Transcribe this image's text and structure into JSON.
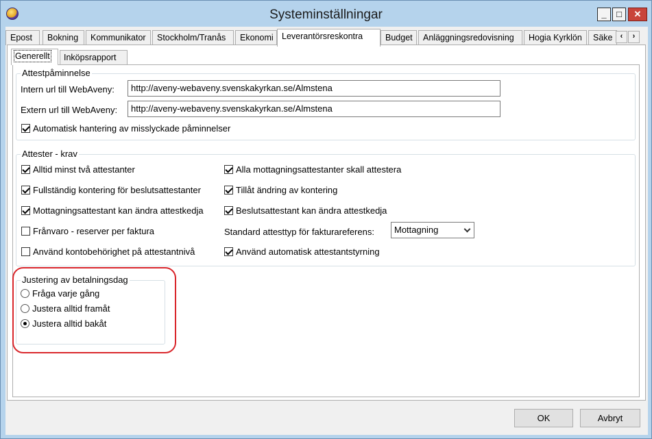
{
  "window": {
    "title": "Systeminställningar"
  },
  "tabs": [
    "Epost",
    "Bokning",
    "Kommunikator",
    "Stockholm/Tranås",
    "Ekonomi",
    "Leverantörsreskontra",
    "Budget",
    "Anläggningsredovisning",
    "Hogia Kyrklön",
    "Säke"
  ],
  "active_tab": "Leverantörsreskontra",
  "inner_tabs": [
    "Generellt",
    "Inköpsrapport"
  ],
  "active_inner_tab": "Generellt",
  "attest_reminder": {
    "legend": "Attestpåminnelse",
    "intern_label": "Intern url till WebAveny:",
    "intern_value": "http://aveny-webaveny.svenskakyrkan.se/Almstena",
    "extern_label": "Extern url till WebAveny:",
    "extern_value": "http://aveny-webaveny.svenskakyrkan.se/Almstena",
    "auto_label": "Automatisk hantering av misslyckade påminnelser",
    "auto_checked": true
  },
  "attests": {
    "legend": "Attester - krav",
    "left": [
      {
        "label": "Alltid minst två attestanter",
        "checked": true
      },
      {
        "label": "Fullständig kontering för beslutsattestanter",
        "checked": true
      },
      {
        "label": "Mottagningsattestant kan ändra attestkedja",
        "checked": true
      },
      {
        "label": "Frånvaro - reserver per faktura",
        "checked": false
      },
      {
        "label": "Använd kontobehörighet på attestantnivå",
        "checked": false
      }
    ],
    "right": [
      {
        "label": "Alla mottagningsattestanter skall attestera",
        "checked": true
      },
      {
        "label": "Tillåt ändring av kontering",
        "checked": true
      },
      {
        "label": "Beslutsattestant kan ändra attestkedja",
        "checked": true
      }
    ],
    "default_type_label": "Standard attesttyp för fakturareferens:",
    "default_type_value": "Mottagning",
    "auto_steering": {
      "label": "Använd automatisk attestantstyrning",
      "checked": true
    }
  },
  "payment_day": {
    "legend": "Justering av betalningsdag",
    "options": [
      {
        "label": "Fråga varje gång",
        "checked": false
      },
      {
        "label": "Justera alltid framåt",
        "checked": false
      },
      {
        "label": "Justera alltid bakåt",
        "checked": true
      }
    ]
  },
  "buttons": {
    "ok": "OK",
    "cancel": "Avbryt"
  },
  "icons": {
    "app": "app-logo-icon",
    "scroll_left": "‹",
    "scroll_right": "›",
    "minimize": "_",
    "maximize": "□",
    "close": "✕"
  }
}
